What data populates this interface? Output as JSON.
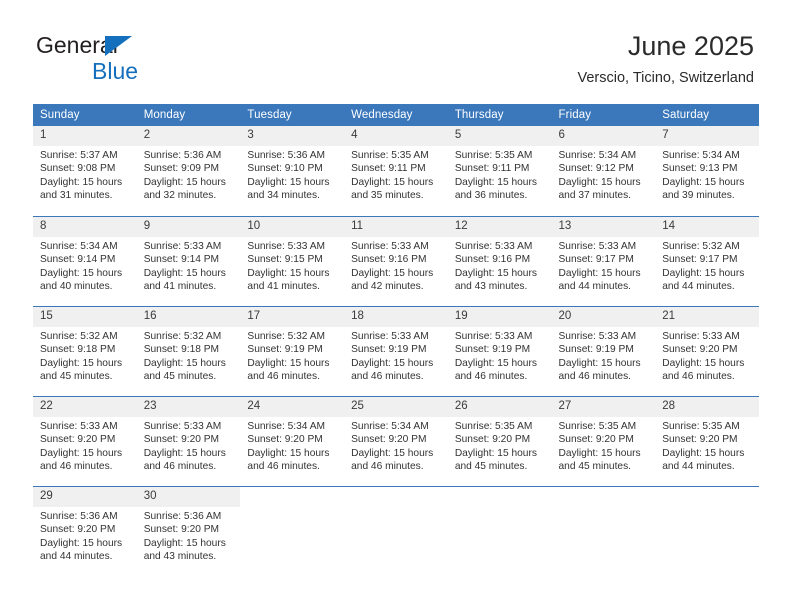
{
  "brand": {
    "line1": "General",
    "line2": "Blue",
    "logo_icon": "blue-triangle-icon",
    "accent_color": "#1470bd"
  },
  "header": {
    "title": "June 2025",
    "subtitle": "Verscio, Ticino, Switzerland"
  },
  "theme": {
    "header_blue": "#3a77bb",
    "daynum_bg": "#f0f0f0",
    "text": "#333333"
  },
  "calendar": {
    "weekday_headers": [
      "Sunday",
      "Monday",
      "Tuesday",
      "Wednesday",
      "Thursday",
      "Friday",
      "Saturday"
    ],
    "weeks": [
      [
        {
          "day": "1",
          "sunrise": "Sunrise: 5:37 AM",
          "sunset": "Sunset: 9:08 PM",
          "daylight1": "Daylight: 15 hours",
          "daylight2": "and 31 minutes."
        },
        {
          "day": "2",
          "sunrise": "Sunrise: 5:36 AM",
          "sunset": "Sunset: 9:09 PM",
          "daylight1": "Daylight: 15 hours",
          "daylight2": "and 32 minutes."
        },
        {
          "day": "3",
          "sunrise": "Sunrise: 5:36 AM",
          "sunset": "Sunset: 9:10 PM",
          "daylight1": "Daylight: 15 hours",
          "daylight2": "and 34 minutes."
        },
        {
          "day": "4",
          "sunrise": "Sunrise: 5:35 AM",
          "sunset": "Sunset: 9:11 PM",
          "daylight1": "Daylight: 15 hours",
          "daylight2": "and 35 minutes."
        },
        {
          "day": "5",
          "sunrise": "Sunrise: 5:35 AM",
          "sunset": "Sunset: 9:11 PM",
          "daylight1": "Daylight: 15 hours",
          "daylight2": "and 36 minutes."
        },
        {
          "day": "6",
          "sunrise": "Sunrise: 5:34 AM",
          "sunset": "Sunset: 9:12 PM",
          "daylight1": "Daylight: 15 hours",
          "daylight2": "and 37 minutes."
        },
        {
          "day": "7",
          "sunrise": "Sunrise: 5:34 AM",
          "sunset": "Sunset: 9:13 PM",
          "daylight1": "Daylight: 15 hours",
          "daylight2": "and 39 minutes."
        }
      ],
      [
        {
          "day": "8",
          "sunrise": "Sunrise: 5:34 AM",
          "sunset": "Sunset: 9:14 PM",
          "daylight1": "Daylight: 15 hours",
          "daylight2": "and 40 minutes."
        },
        {
          "day": "9",
          "sunrise": "Sunrise: 5:33 AM",
          "sunset": "Sunset: 9:14 PM",
          "daylight1": "Daylight: 15 hours",
          "daylight2": "and 41 minutes."
        },
        {
          "day": "10",
          "sunrise": "Sunrise: 5:33 AM",
          "sunset": "Sunset: 9:15 PM",
          "daylight1": "Daylight: 15 hours",
          "daylight2": "and 41 minutes."
        },
        {
          "day": "11",
          "sunrise": "Sunrise: 5:33 AM",
          "sunset": "Sunset: 9:16 PM",
          "daylight1": "Daylight: 15 hours",
          "daylight2": "and 42 minutes."
        },
        {
          "day": "12",
          "sunrise": "Sunrise: 5:33 AM",
          "sunset": "Sunset: 9:16 PM",
          "daylight1": "Daylight: 15 hours",
          "daylight2": "and 43 minutes."
        },
        {
          "day": "13",
          "sunrise": "Sunrise: 5:33 AM",
          "sunset": "Sunset: 9:17 PM",
          "daylight1": "Daylight: 15 hours",
          "daylight2": "and 44 minutes."
        },
        {
          "day": "14",
          "sunrise": "Sunrise: 5:32 AM",
          "sunset": "Sunset: 9:17 PM",
          "daylight1": "Daylight: 15 hours",
          "daylight2": "and 44 minutes."
        }
      ],
      [
        {
          "day": "15",
          "sunrise": "Sunrise: 5:32 AM",
          "sunset": "Sunset: 9:18 PM",
          "daylight1": "Daylight: 15 hours",
          "daylight2": "and 45 minutes."
        },
        {
          "day": "16",
          "sunrise": "Sunrise: 5:32 AM",
          "sunset": "Sunset: 9:18 PM",
          "daylight1": "Daylight: 15 hours",
          "daylight2": "and 45 minutes."
        },
        {
          "day": "17",
          "sunrise": "Sunrise: 5:32 AM",
          "sunset": "Sunset: 9:19 PM",
          "daylight1": "Daylight: 15 hours",
          "daylight2": "and 46 minutes."
        },
        {
          "day": "18",
          "sunrise": "Sunrise: 5:33 AM",
          "sunset": "Sunset: 9:19 PM",
          "daylight1": "Daylight: 15 hours",
          "daylight2": "and 46 minutes."
        },
        {
          "day": "19",
          "sunrise": "Sunrise: 5:33 AM",
          "sunset": "Sunset: 9:19 PM",
          "daylight1": "Daylight: 15 hours",
          "daylight2": "and 46 minutes."
        },
        {
          "day": "20",
          "sunrise": "Sunrise: 5:33 AM",
          "sunset": "Sunset: 9:19 PM",
          "daylight1": "Daylight: 15 hours",
          "daylight2": "and 46 minutes."
        },
        {
          "day": "21",
          "sunrise": "Sunrise: 5:33 AM",
          "sunset": "Sunset: 9:20 PM",
          "daylight1": "Daylight: 15 hours",
          "daylight2": "and 46 minutes."
        }
      ],
      [
        {
          "day": "22",
          "sunrise": "Sunrise: 5:33 AM",
          "sunset": "Sunset: 9:20 PM",
          "daylight1": "Daylight: 15 hours",
          "daylight2": "and 46 minutes."
        },
        {
          "day": "23",
          "sunrise": "Sunrise: 5:33 AM",
          "sunset": "Sunset: 9:20 PM",
          "daylight1": "Daylight: 15 hours",
          "daylight2": "and 46 minutes."
        },
        {
          "day": "24",
          "sunrise": "Sunrise: 5:34 AM",
          "sunset": "Sunset: 9:20 PM",
          "daylight1": "Daylight: 15 hours",
          "daylight2": "and 46 minutes."
        },
        {
          "day": "25",
          "sunrise": "Sunrise: 5:34 AM",
          "sunset": "Sunset: 9:20 PM",
          "daylight1": "Daylight: 15 hours",
          "daylight2": "and 46 minutes."
        },
        {
          "day": "26",
          "sunrise": "Sunrise: 5:35 AM",
          "sunset": "Sunset: 9:20 PM",
          "daylight1": "Daylight: 15 hours",
          "daylight2": "and 45 minutes."
        },
        {
          "day": "27",
          "sunrise": "Sunrise: 5:35 AM",
          "sunset": "Sunset: 9:20 PM",
          "daylight1": "Daylight: 15 hours",
          "daylight2": "and 45 minutes."
        },
        {
          "day": "28",
          "sunrise": "Sunrise: 5:35 AM",
          "sunset": "Sunset: 9:20 PM",
          "daylight1": "Daylight: 15 hours",
          "daylight2": "and 44 minutes."
        }
      ],
      [
        {
          "day": "29",
          "sunrise": "Sunrise: 5:36 AM",
          "sunset": "Sunset: 9:20 PM",
          "daylight1": "Daylight: 15 hours",
          "daylight2": "and 44 minutes."
        },
        {
          "day": "30",
          "sunrise": "Sunrise: 5:36 AM",
          "sunset": "Sunset: 9:20 PM",
          "daylight1": "Daylight: 15 hours",
          "daylight2": "and 43 minutes."
        },
        {
          "day": "",
          "sunrise": "",
          "sunset": "",
          "daylight1": "",
          "daylight2": ""
        },
        {
          "day": "",
          "sunrise": "",
          "sunset": "",
          "daylight1": "",
          "daylight2": ""
        },
        {
          "day": "",
          "sunrise": "",
          "sunset": "",
          "daylight1": "",
          "daylight2": ""
        },
        {
          "day": "",
          "sunrise": "",
          "sunset": "",
          "daylight1": "",
          "daylight2": ""
        },
        {
          "day": "",
          "sunrise": "",
          "sunset": "",
          "daylight1": "",
          "daylight2": ""
        }
      ]
    ]
  }
}
